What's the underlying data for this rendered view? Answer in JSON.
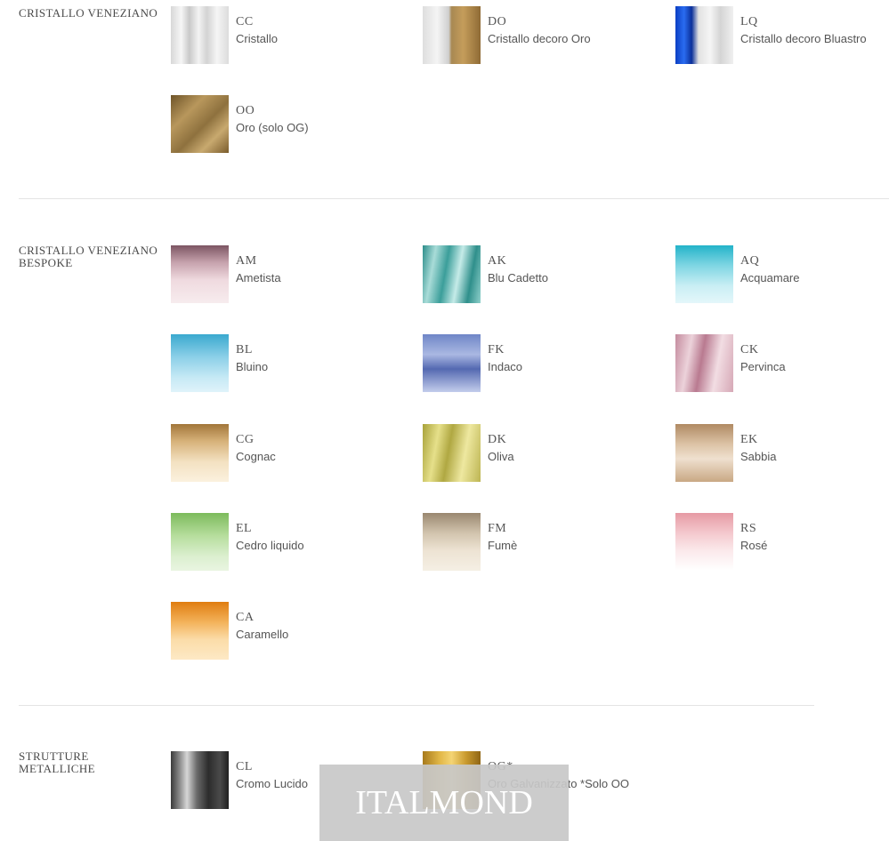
{
  "sections": [
    {
      "title": "CRISTALLO VENEZIANO",
      "items": [
        {
          "code": "CC",
          "name": "Cristallo",
          "swatch_icon": "clear-glass-swatch"
        },
        {
          "code": "DO",
          "name": "Cristallo decoro Oro",
          "swatch_icon": "clear-gold-glass-swatch"
        },
        {
          "code": "LQ",
          "name": "Cristallo decoro Bluastro",
          "swatch_icon": "clear-blue-glass-swatch"
        },
        {
          "code": "OO",
          "name": "Oro (solo OG)",
          "swatch_icon": "gold-glass-swatch"
        }
      ]
    },
    {
      "title": "CRISTALLO VENEZIANO BESPOKE",
      "items": [
        {
          "code": "AM",
          "name": "Ametista",
          "swatch_icon": "amethyst-glass-swatch"
        },
        {
          "code": "AK",
          "name": "Blu Cadetto",
          "swatch_icon": "cadet-blue-glass-swatch"
        },
        {
          "code": "AQ",
          "name": "Acquamare",
          "swatch_icon": "aquamarine-glass-swatch"
        },
        {
          "code": "BL",
          "name": "Bluino",
          "swatch_icon": "light-blue-glass-swatch"
        },
        {
          "code": "FK",
          "name": "Indaco",
          "swatch_icon": "indigo-glass-swatch"
        },
        {
          "code": "CK",
          "name": "Pervinca",
          "swatch_icon": "periwinkle-glass-swatch"
        },
        {
          "code": "CG",
          "name": "Cognac",
          "swatch_icon": "cognac-glass-swatch"
        },
        {
          "code": "DK",
          "name": "Oliva",
          "swatch_icon": "olive-glass-swatch"
        },
        {
          "code": "EK",
          "name": "Sabbia",
          "swatch_icon": "sand-glass-swatch"
        },
        {
          "code": "EL",
          "name": "Cedro liquido",
          "swatch_icon": "cedar-green-glass-swatch"
        },
        {
          "code": "FM",
          "name": "Fumè",
          "swatch_icon": "smoke-glass-swatch"
        },
        {
          "code": "RS",
          "name": "Rosé",
          "swatch_icon": "rose-glass-swatch"
        },
        {
          "code": "CA",
          "name": "Caramello",
          "swatch_icon": "caramel-glass-swatch"
        }
      ]
    },
    {
      "title": "STRUTTURE METALLICHE",
      "items": [
        {
          "code": "CL",
          "name": "Cromo Lucido",
          "swatch_icon": "chrome-metal-swatch"
        },
        {
          "code": "OG*",
          "name": "Oro Galvanizzato *Solo OO",
          "swatch_icon": "gold-metal-swatch"
        }
      ]
    }
  ],
  "watermark": "ITALMOND",
  "colors": {
    "text": "#555555",
    "divider": "#e4e4e4",
    "watermark_bg": "#c8c8c8"
  }
}
